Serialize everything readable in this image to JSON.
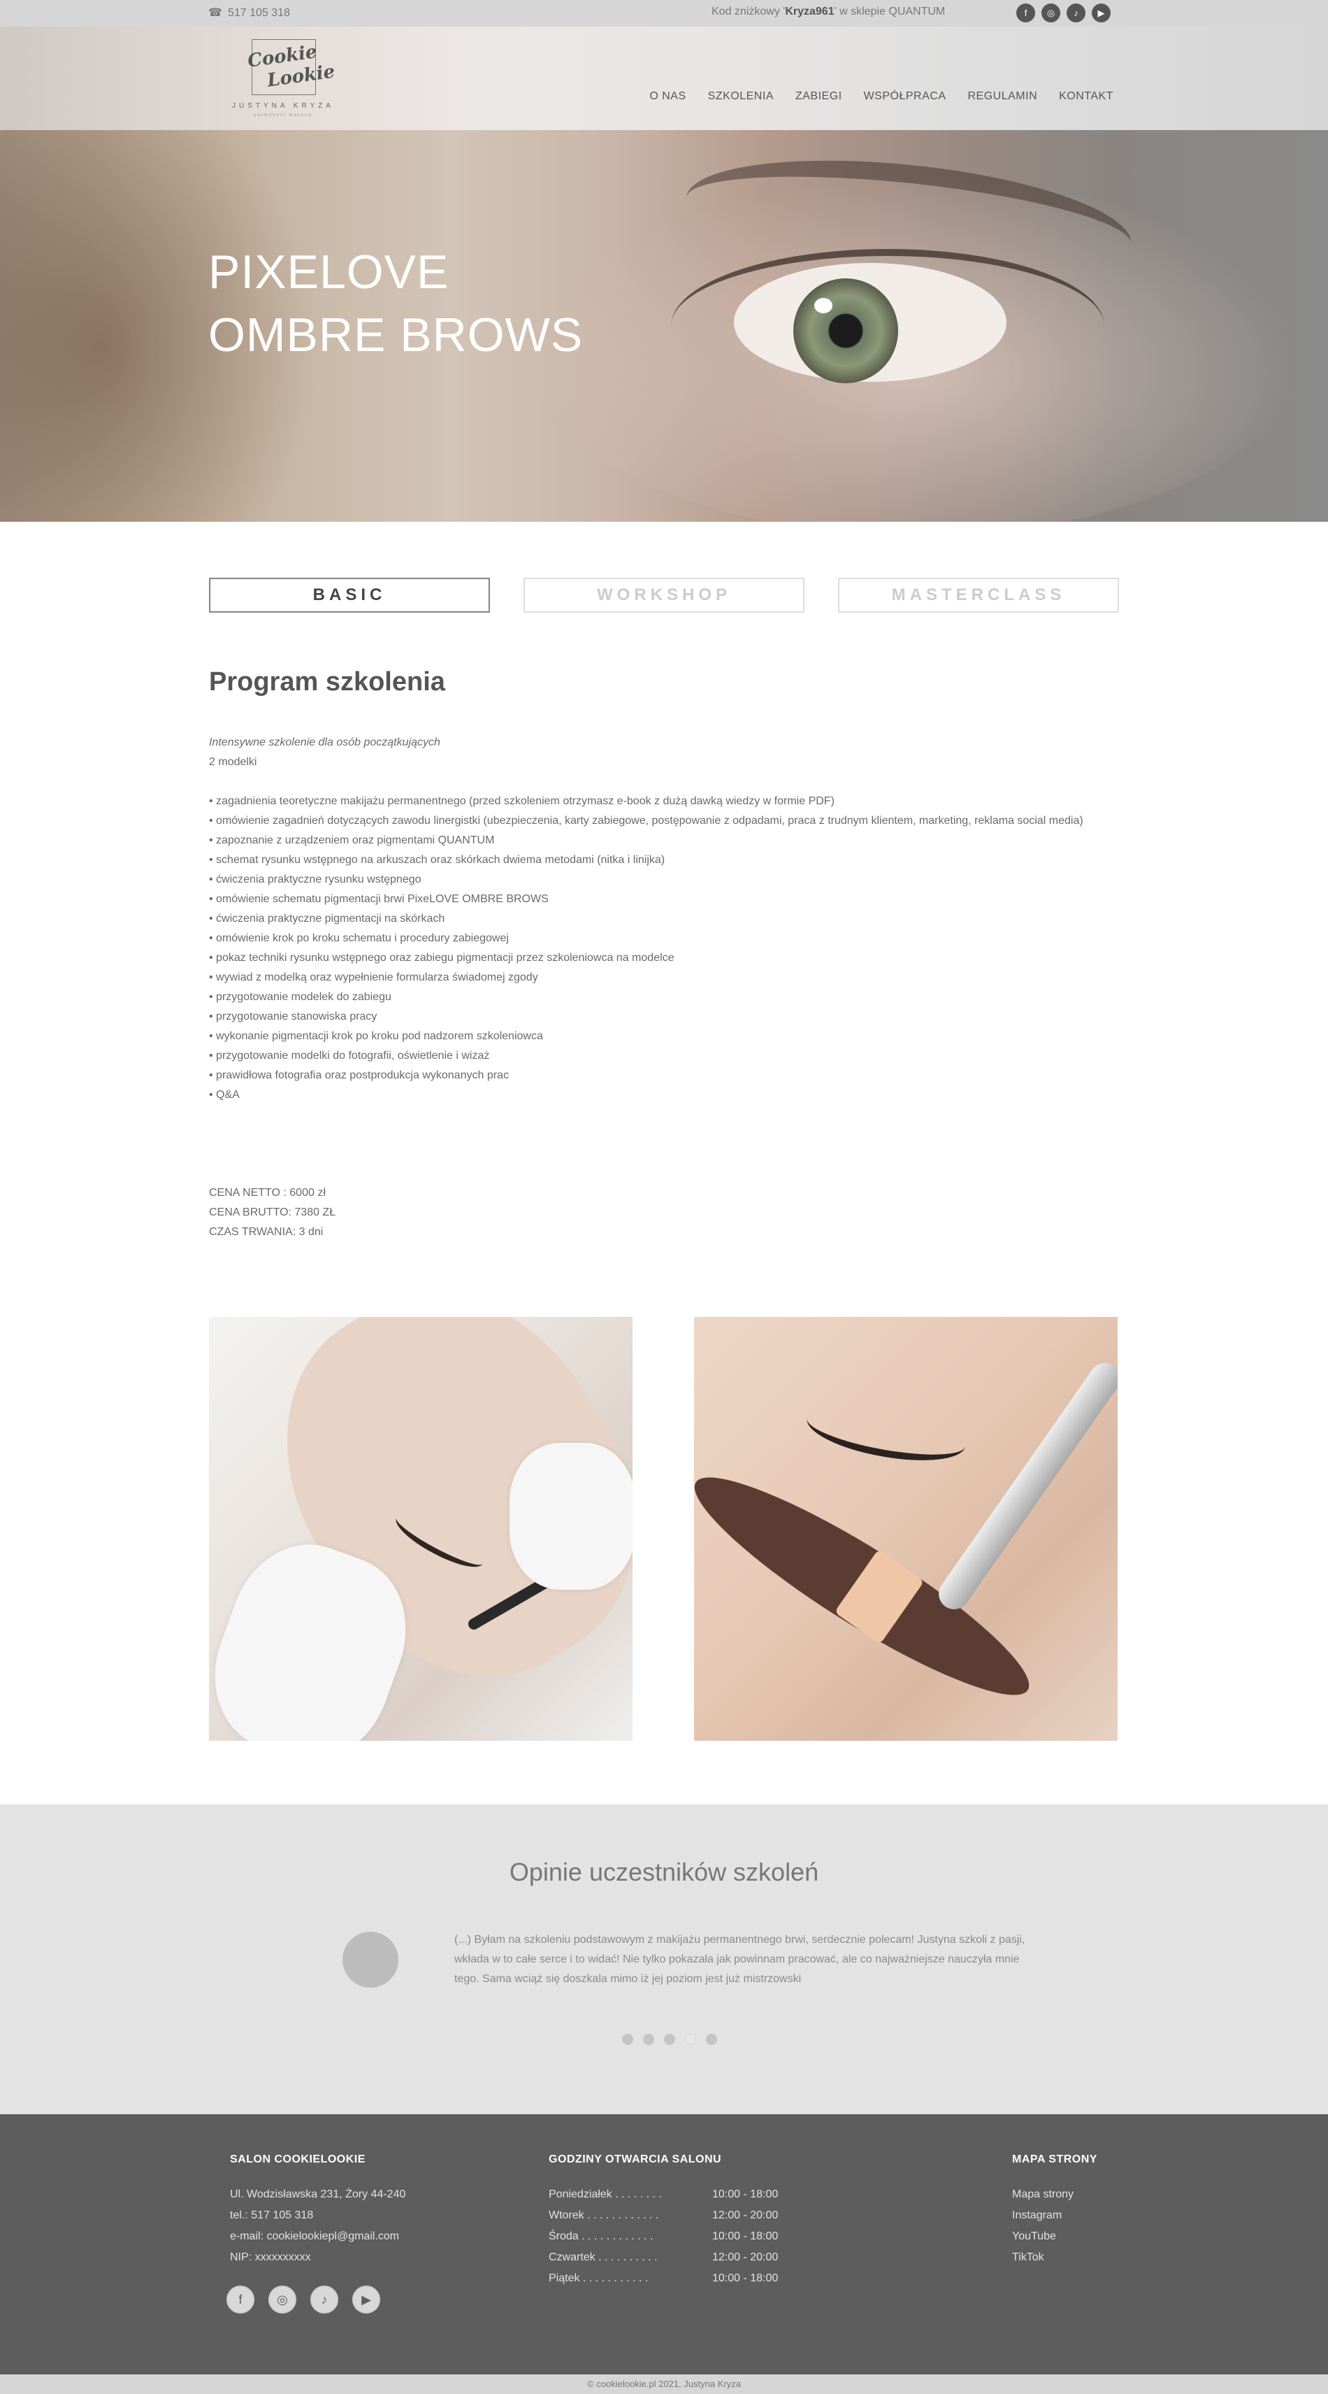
{
  "topbar": {
    "phone": "517 105 318",
    "promo_prefix": "Kod zniżkowy '",
    "promo_code": "Kryza961",
    "promo_suffix": "' w sklepie",
    "promo_shop": "QUANTUM",
    "social": [
      "facebook-icon",
      "instagram-icon",
      "tiktok-icon",
      "youtube-icon"
    ]
  },
  "logo": {
    "line1": "Cookie",
    "line2": "Lookie",
    "subtitle": "JUSTYNA KRYZA",
    "tagline": "permanent makeup"
  },
  "nav": [
    "O NAS",
    "SZKOLENIA",
    "ZABIEGI",
    "WSPÓŁPRACA",
    "REGULAMIN",
    "KONTAKT"
  ],
  "hero": {
    "line1": "PIXELOVE",
    "line2": "OMBRE BROWS"
  },
  "tabs": [
    {
      "label": "BASIC",
      "active": true
    },
    {
      "label": "WORKSHOP",
      "active": false
    },
    {
      "label": "MASTERCLASS",
      "active": false
    }
  ],
  "program": {
    "title": "Program szkolenia",
    "intro": "Intensywne szkolenie dla osób początkujących",
    "models": "2 modelki",
    "items": [
      "zagadnienia teoretyczne makijażu permanentnego (przed szkoleniem otrzymasz e-book z dużą dawką wiedzy w formie PDF)",
      "omówienie zagadnień dotyczących zawodu linergistki (ubezpieczenia, karty zabiegowe, postępowanie z odpadami, praca z trudnym klientem, marketing, reklama social media)",
      "zapoznanie z urządzeniem oraz pigmentami QUANTUM",
      "schemat rysunku wstępnego na arkuszach oraz skórkach dwiema metodami (nitka i linijka)",
      "ćwiczenia praktyczne rysunku wstępnego",
      "omówienie schematu pigmentacji brwi PixeLOVE OMBRE BROWS",
      "ćwiczenia praktyczne  pigmentacji na skórkach",
      "omówienie krok po kroku schematu i procedury zabiegowej",
      "pokaz techniki rysunku wstępnego oraz zabiegu pigmentacji przez szkoleniowca na modelce",
      "wywiad z modelką oraz wypełnienie formularza świadomej zgody",
      "przygotowanie modelek do zabiegu",
      "przygotowanie stanowiska pracy",
      "wykonanie pigmentacji krok po kroku pod nadzorem szkoleniowca",
      "przygotowanie modelki do fotografii, oświetlenie i wizaż",
      "prawidłowa fotografia oraz postprodukcja wykonanych prac",
      "Q&A"
    ],
    "price_net": "CENA NETTO : 6000 zł",
    "price_gross": "CENA BRUTTO: 7380 ZŁ",
    "duration": "CZAS TRWANIA: 3 dni"
  },
  "testimonials": {
    "title": "Opinie uczestników szkoleń",
    "quote": "(...) Byłam na szkoleniu podstawowym z makijażu permanentnego brwi, serdecznie polecam! Justyna szkoli z pasji, wkłada w to całe serce i to widać! Nie tylko pokazała jak powinnam pracować, ale co najważniejsze nauczyła mnie tego. Sama wciąż się doszkala mimo iż jej poziom jest już mistrzowski",
    "dots": 5,
    "active_dot": 4
  },
  "footer": {
    "salon": {
      "heading": "SALON COOKIELOOKIE",
      "address": "Ul. Wodzisławska 231, Żory 44-240",
      "phone": "tel.: 517 105 318",
      "email": "e-mail: cookielookiepl@gmail.com",
      "nip": "NIP: xxxxxxxxxx"
    },
    "hours": {
      "heading": "GODZINY OTWARCIA SALONU",
      "rows": [
        {
          "day": "Poniedziałek  .  .  .  .  .  .  .  .",
          "time": "10:00 - 18:00"
        },
        {
          "day": "Wtorek  .  .  .  .  .  .  .  .  .  .  .  .",
          "time": "12:00 - 20:00"
        },
        {
          "day": "Środa .  .  .  .  .  .  .  .  .  .  .  .",
          "time": "10:00 - 18:00"
        },
        {
          "day": "Czwartek  .  .  .  .  .  .  .  .  .  .",
          "time": "12:00 - 20:00"
        },
        {
          "day": "Piątek  .  .  .  .  .  .  .  .  .  .  .",
          "time": "10:00 - 18:00"
        }
      ]
    },
    "sitemap": {
      "heading": "MAPA STRONY",
      "links": [
        "Mapa strony",
        "Instagram",
        "YouTube",
        "TikTok"
      ]
    },
    "social": [
      "facebook-icon",
      "instagram-icon",
      "tiktok-icon",
      "youtube-icon"
    ],
    "copyright": "© cookielookie.pl 2021, Justyna Kryza"
  }
}
